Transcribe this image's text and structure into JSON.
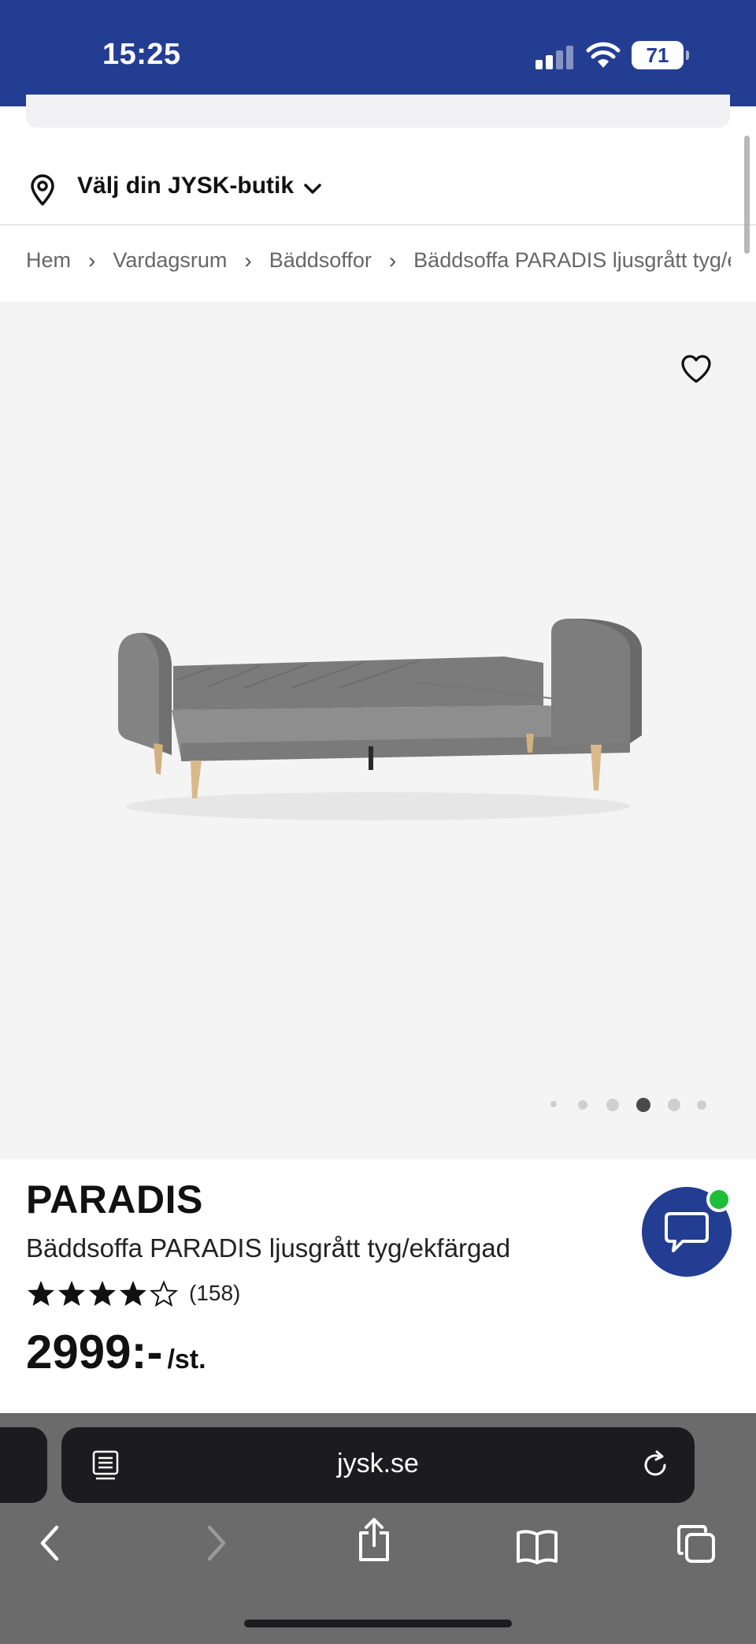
{
  "status_bar": {
    "time": "15:25",
    "battery": "71",
    "icons": [
      "signal-icon",
      "wifi-icon",
      "battery-icon"
    ]
  },
  "store": {
    "label": "Välj din JYSK-butik",
    "icons": [
      "location-pin-icon",
      "chevron-down-icon"
    ]
  },
  "breadcrumb": [
    "Hem",
    "Vardagsrum",
    "Bäddsoffor",
    "Bäddsoffa PARADIS ljusgrått tyg/e"
  ],
  "gallery": {
    "image_count": 6,
    "active_index": 3,
    "icons": [
      "heart-icon"
    ]
  },
  "product": {
    "brand": "PARADIS",
    "name": "Bäddsoffa PARADIS ljusgrått tyg/ekfärgad",
    "rating": 4,
    "rating_max": 5,
    "review_count": "(158)",
    "price": "2999:-",
    "price_unit": "/st."
  },
  "chat": {
    "icons": [
      "chat-bubble-icon"
    ],
    "online_color": "#1dbf3a"
  },
  "browser": {
    "url": "jysk.se",
    "icons": [
      "reader-icon",
      "reload-icon",
      "back-icon",
      "forward-icon",
      "share-icon",
      "bookmarks-icon",
      "tabs-icon"
    ]
  },
  "colors": {
    "brand_blue": "#233d92"
  }
}
